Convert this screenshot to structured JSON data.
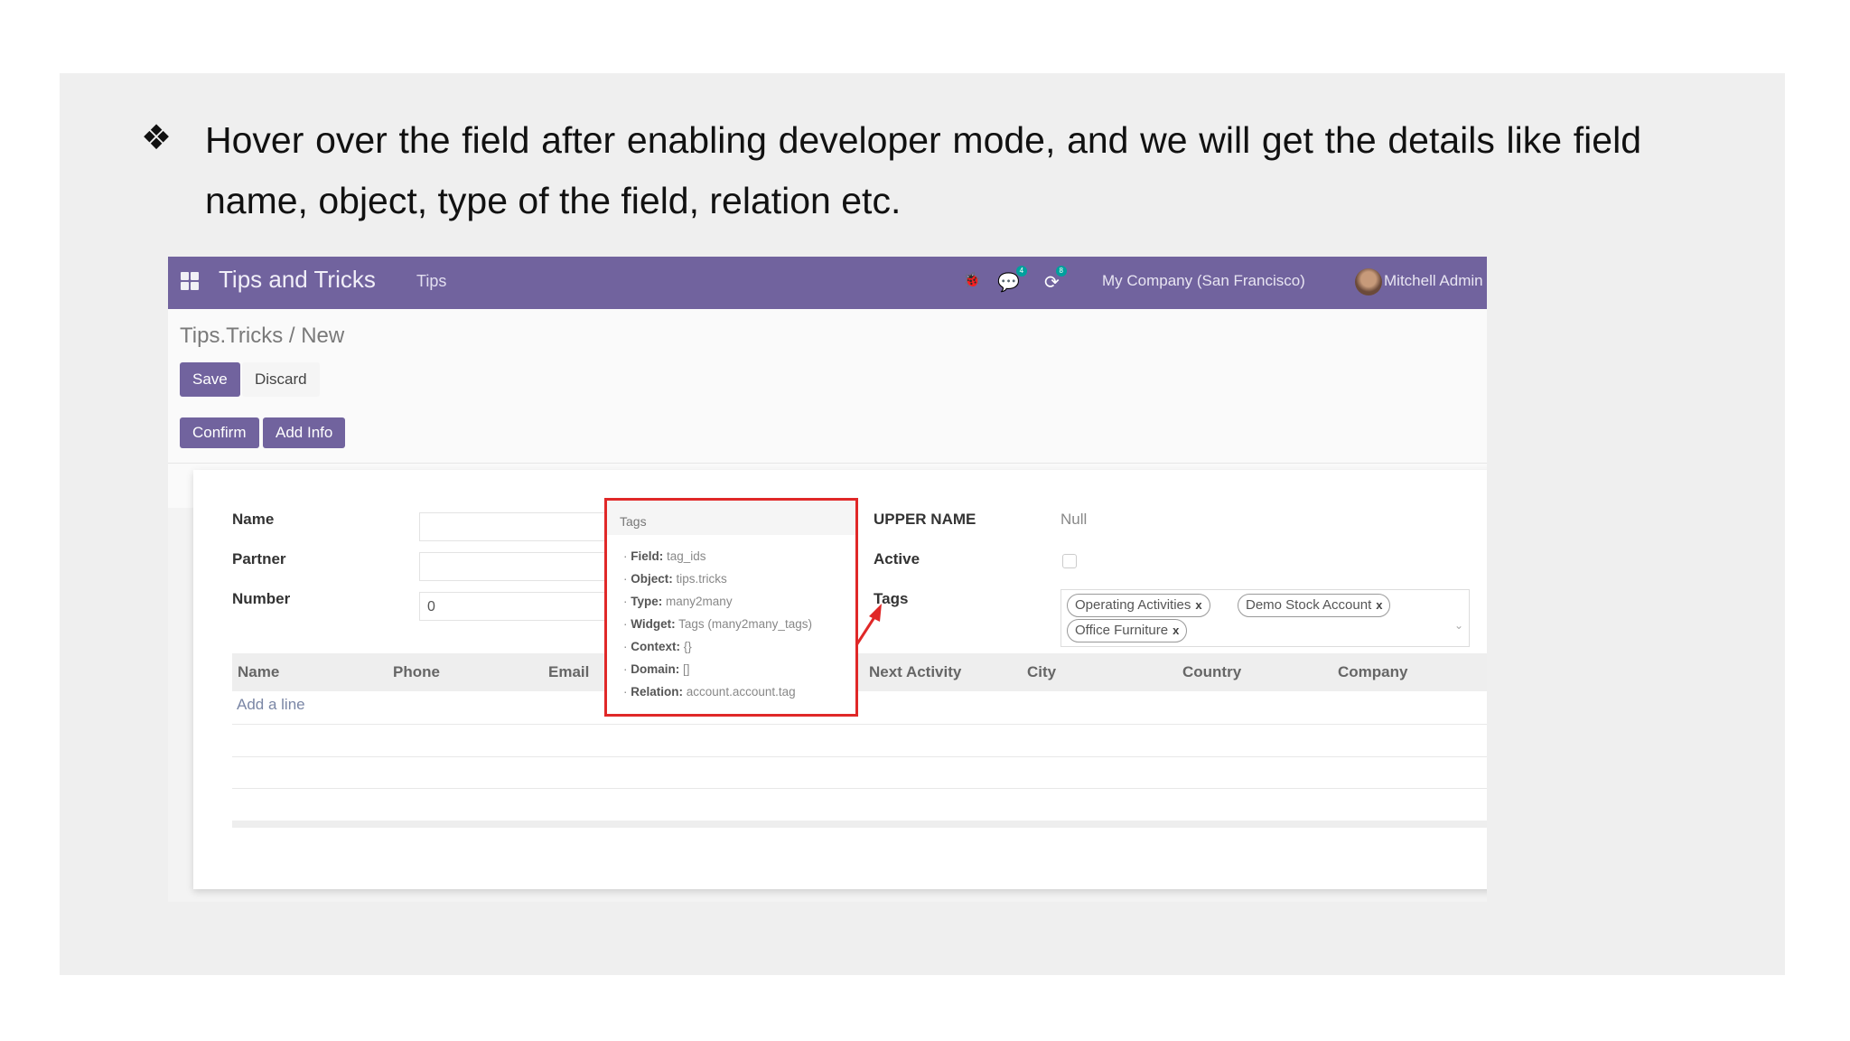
{
  "slide": {
    "bullet": "❖",
    "caption": "Hover over the field after enabling developer mode, and we will get the details like field name, object, type of the field, relation etc."
  },
  "navbar": {
    "app_title": "Tips and Tricks",
    "menu_item": "Tips",
    "bug_icon": "🐞",
    "chat_icon": "💬",
    "chat_badge": "4",
    "clock_icon": "⟳",
    "clock_badge": "8",
    "company": "My Company (San Francisco)",
    "user": "Mitchell Admin"
  },
  "breadcrumb": "Tips.Tricks / New",
  "buttons": {
    "save": "Save",
    "discard": "Discard",
    "confirm": "Confirm",
    "add_info": "Add Info"
  },
  "form": {
    "name_label": "Name",
    "partner_label": "Partner",
    "number_label": "Number",
    "number_value": "0",
    "upper_name_label": "UPPER NAME",
    "upper_name_value": "Null",
    "active_label": "Active",
    "tags_label": "Tags",
    "tags": [
      "Operating Activities",
      "Demo Stock Account",
      "Office Furniture"
    ],
    "tag_remove": "x",
    "dropdown_caret": "⌄"
  },
  "table": {
    "columns": [
      "Name",
      "Phone",
      "Email",
      "Next Activity",
      "City",
      "Country",
      "Company"
    ],
    "add_line": "Add a line"
  },
  "tooltip": {
    "title": "Tags",
    "rows": [
      {
        "key": "Field:",
        "value": "tag_ids"
      },
      {
        "key": "Object:",
        "value": "tips.tricks"
      },
      {
        "key": "Type:",
        "value": "many2many"
      },
      {
        "key": "Widget:",
        "value": "Tags (many2many_tags)"
      },
      {
        "key": "Context:",
        "value": "{}"
      },
      {
        "key": "Domain:",
        "value": "[]"
      },
      {
        "key": "Relation:",
        "value": "account.account.tag"
      }
    ]
  },
  "colors": {
    "brand": "#71639e",
    "highlight": "#e02828"
  }
}
